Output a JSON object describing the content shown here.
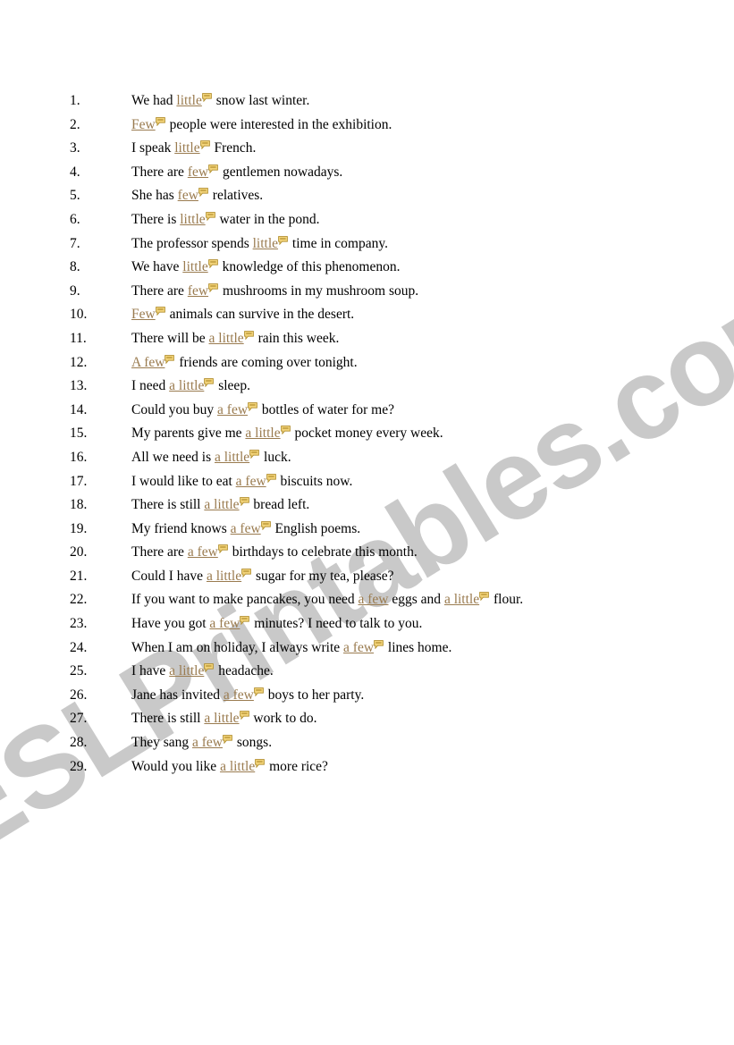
{
  "document": {
    "type": "esl-worksheet",
    "background_color": "#ffffff",
    "text_color": "#000000",
    "highlight_color": "#9a7b4f",
    "watermark": {
      "text": "ESLPrintables.com",
      "color": "#c9c9c9",
      "rotation_deg": -31.5
    },
    "icon": {
      "name": "comment-bubble-icon",
      "fill_color": "#f2d37a",
      "stroke_color": "#b28f2e"
    }
  },
  "sentences": [
    {
      "n": "1.",
      "parts": [
        {
          "t": "We had ",
          "hl": false
        },
        {
          "t": "little",
          "hl": true,
          "icon": true
        },
        {
          "t": " snow last winter.",
          "hl": false
        }
      ]
    },
    {
      "n": "2.",
      "parts": [
        {
          "t": "Few",
          "hl": true,
          "icon": true
        },
        {
          "t": " people were interested in the exhibition.",
          "hl": false
        }
      ]
    },
    {
      "n": "3.",
      "parts": [
        {
          "t": "I speak ",
          "hl": false
        },
        {
          "t": "little",
          "hl": true,
          "icon": true
        },
        {
          "t": " French.",
          "hl": false
        }
      ]
    },
    {
      "n": "4.",
      "parts": [
        {
          "t": "There are ",
          "hl": false
        },
        {
          "t": "few",
          "hl": true,
          "icon": true
        },
        {
          "t": " gentlemen nowadays.",
          "hl": false
        }
      ]
    },
    {
      "n": "5.",
      "parts": [
        {
          "t": "She has ",
          "hl": false
        },
        {
          "t": "few",
          "hl": true,
          "icon": true
        },
        {
          "t": " relatives.",
          "hl": false
        }
      ]
    },
    {
      "n": "6.",
      "parts": [
        {
          "t": "There is ",
          "hl": false
        },
        {
          "t": "little",
          "hl": true,
          "icon": true
        },
        {
          "t": " water in the pond.",
          "hl": false
        }
      ]
    },
    {
      "n": "7.",
      "parts": [
        {
          "t": "The professor spends ",
          "hl": false
        },
        {
          "t": "little",
          "hl": true,
          "icon": true
        },
        {
          "t": " time in company.",
          "hl": false
        }
      ]
    },
    {
      "n": "8.",
      "parts": [
        {
          "t": "We have ",
          "hl": false
        },
        {
          "t": "little",
          "hl": true,
          "icon": true
        },
        {
          "t": " knowledge of this phenomenon.",
          "hl": false
        }
      ]
    },
    {
      "n": "9.",
      "parts": [
        {
          "t": "There are ",
          "hl": false
        },
        {
          "t": "few",
          "hl": true,
          "icon": true
        },
        {
          "t": " mushrooms in my mushroom soup.",
          "hl": false
        }
      ]
    },
    {
      "n": "10.",
      "parts": [
        {
          "t": "Few",
          "hl": true,
          "icon": true
        },
        {
          "t": " animals can survive in the desert.",
          "hl": false
        }
      ]
    },
    {
      "n": "11.",
      "parts": [
        {
          "t": "There will be ",
          "hl": false
        },
        {
          "t": "a little",
          "hl": true,
          "icon": true
        },
        {
          "t": " rain this week.",
          "hl": false
        }
      ]
    },
    {
      "n": "12.",
      "parts": [
        {
          "t": "A few",
          "hl": true,
          "icon": true
        },
        {
          "t": " friends are coming over tonight.",
          "hl": false
        }
      ]
    },
    {
      "n": "13.",
      "parts": [
        {
          "t": "I need ",
          "hl": false
        },
        {
          "t": "a little",
          "hl": true,
          "icon": true
        },
        {
          "t": " sleep.",
          "hl": false
        }
      ]
    },
    {
      "n": "14.",
      "parts": [
        {
          "t": "Could you buy ",
          "hl": false
        },
        {
          "t": "a few",
          "hl": true,
          "icon": true
        },
        {
          "t": " bottles of water for me?",
          "hl": false
        }
      ]
    },
    {
      "n": "15.",
      "parts": [
        {
          "t": "My parents give me ",
          "hl": false
        },
        {
          "t": "a little",
          "hl": true,
          "icon": true
        },
        {
          "t": " pocket money every week.",
          "hl": false
        }
      ]
    },
    {
      "n": "16.",
      "parts": [
        {
          "t": "All we need is ",
          "hl": false
        },
        {
          "t": "a little",
          "hl": true,
          "icon": true
        },
        {
          "t": " luck.",
          "hl": false
        }
      ]
    },
    {
      "n": "17.",
      "parts": [
        {
          "t": "I would like to eat ",
          "hl": false
        },
        {
          "t": "a few",
          "hl": true,
          "icon": true
        },
        {
          "t": " biscuits now.",
          "hl": false
        }
      ]
    },
    {
      "n": "18.",
      "parts": [
        {
          "t": "There is still ",
          "hl": false
        },
        {
          "t": "a little",
          "hl": true,
          "icon": true
        },
        {
          "t": " bread left.",
          "hl": false
        }
      ]
    },
    {
      "n": "19.",
      "parts": [
        {
          "t": "My friend knows ",
          "hl": false
        },
        {
          "t": "a few",
          "hl": true,
          "icon": true
        },
        {
          "t": " English poems.",
          "hl": false
        }
      ]
    },
    {
      "n": "20.",
      "parts": [
        {
          "t": "There are ",
          "hl": false
        },
        {
          "t": "a few",
          "hl": true,
          "icon": true
        },
        {
          "t": " birthdays to celebrate this month.",
          "hl": false
        }
      ]
    },
    {
      "n": "21.",
      "parts": [
        {
          "t": "Could I have ",
          "hl": false
        },
        {
          "t": "a little",
          "hl": true,
          "icon": true
        },
        {
          "t": " sugar for my tea, please?",
          "hl": false
        }
      ]
    },
    {
      "n": "22.",
      "parts": [
        {
          "t": "If you want to make pancakes, you need ",
          "hl": false
        },
        {
          "t": "a few",
          "hl": true,
          "icon": false
        },
        {
          "t": " eggs and ",
          "hl": false
        },
        {
          "t": "a little",
          "hl": true,
          "icon": true
        },
        {
          "t": " flour.",
          "hl": false
        }
      ]
    },
    {
      "n": "23.",
      "parts": [
        {
          "t": " Have you got ",
          "hl": false
        },
        {
          "t": "a few",
          "hl": true,
          "icon": true
        },
        {
          "t": " minutes? I need to talk to you.",
          "hl": false
        }
      ]
    },
    {
      "n": "24.",
      "parts": [
        {
          "t": "When I am on holiday, I always write ",
          "hl": false
        },
        {
          "t": "a few",
          "hl": true,
          "icon": true
        },
        {
          "t": " lines home.",
          "hl": false
        }
      ]
    },
    {
      "n": "25.",
      "parts": [
        {
          "t": "I have ",
          "hl": false
        },
        {
          "t": "a little",
          "hl": true,
          "icon": true
        },
        {
          "t": " headache.",
          "hl": false
        }
      ]
    },
    {
      "n": "26.",
      "parts": [
        {
          "t": "Jane has invited ",
          "hl": false
        },
        {
          "t": "a few",
          "hl": true,
          "icon": true
        },
        {
          "t": " boys to her party.",
          "hl": false
        }
      ]
    },
    {
      "n": "27.",
      "parts": [
        {
          "t": "There is still ",
          "hl": false
        },
        {
          "t": "a little",
          "hl": true,
          "icon": true
        },
        {
          "t": " work to do.",
          "hl": false
        }
      ]
    },
    {
      "n": "28.",
      "parts": [
        {
          "t": "They sang ",
          "hl": false
        },
        {
          "t": "a few",
          "hl": true,
          "icon": true
        },
        {
          "t": " songs.",
          "hl": false
        }
      ]
    },
    {
      "n": "29.",
      "parts": [
        {
          "t": " Would you like ",
          "hl": false
        },
        {
          "t": "a little",
          "hl": true,
          "icon": true
        },
        {
          "t": " more rice?",
          "hl": false
        }
      ]
    }
  ]
}
